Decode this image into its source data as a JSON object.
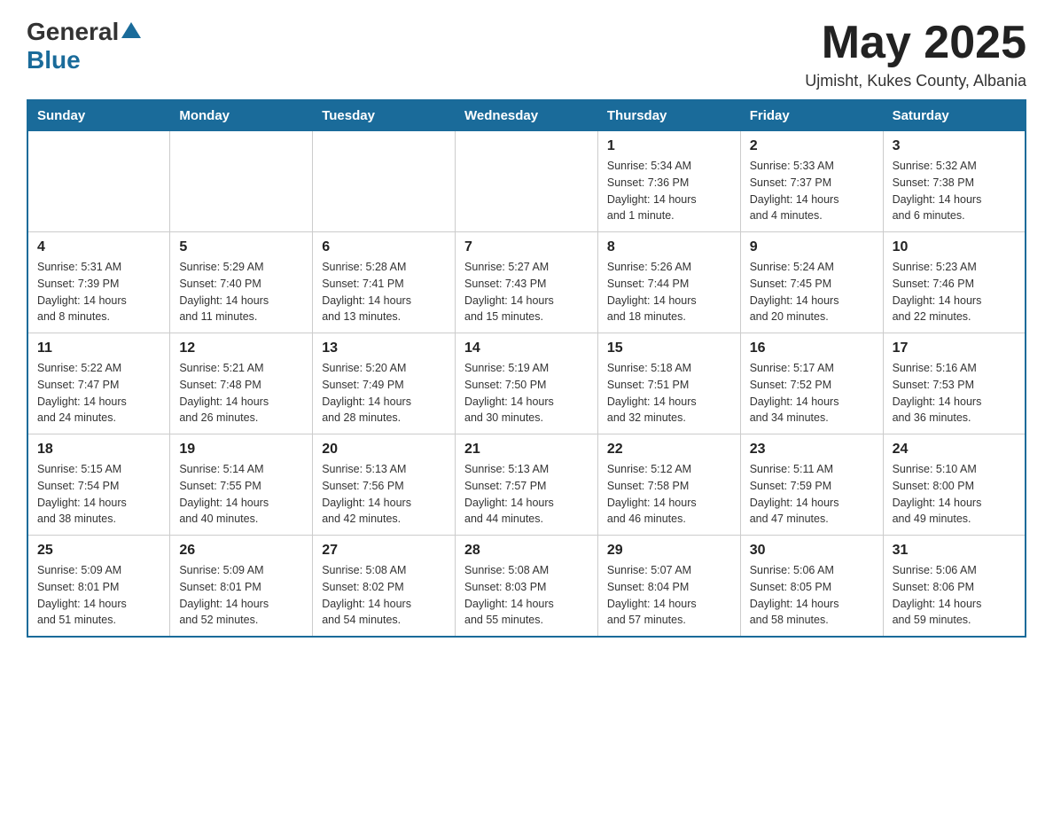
{
  "header": {
    "logo_general": "General",
    "logo_blue": "Blue",
    "title": "May 2025",
    "location": "Ujmisht, Kukes County, Albania"
  },
  "days_of_week": [
    "Sunday",
    "Monday",
    "Tuesday",
    "Wednesday",
    "Thursday",
    "Friday",
    "Saturday"
  ],
  "weeks": [
    [
      {
        "num": "",
        "info": ""
      },
      {
        "num": "",
        "info": ""
      },
      {
        "num": "",
        "info": ""
      },
      {
        "num": "",
        "info": ""
      },
      {
        "num": "1",
        "info": "Sunrise: 5:34 AM\nSunset: 7:36 PM\nDaylight: 14 hours\nand 1 minute."
      },
      {
        "num": "2",
        "info": "Sunrise: 5:33 AM\nSunset: 7:37 PM\nDaylight: 14 hours\nand 4 minutes."
      },
      {
        "num": "3",
        "info": "Sunrise: 5:32 AM\nSunset: 7:38 PM\nDaylight: 14 hours\nand 6 minutes."
      }
    ],
    [
      {
        "num": "4",
        "info": "Sunrise: 5:31 AM\nSunset: 7:39 PM\nDaylight: 14 hours\nand 8 minutes."
      },
      {
        "num": "5",
        "info": "Sunrise: 5:29 AM\nSunset: 7:40 PM\nDaylight: 14 hours\nand 11 minutes."
      },
      {
        "num": "6",
        "info": "Sunrise: 5:28 AM\nSunset: 7:41 PM\nDaylight: 14 hours\nand 13 minutes."
      },
      {
        "num": "7",
        "info": "Sunrise: 5:27 AM\nSunset: 7:43 PM\nDaylight: 14 hours\nand 15 minutes."
      },
      {
        "num": "8",
        "info": "Sunrise: 5:26 AM\nSunset: 7:44 PM\nDaylight: 14 hours\nand 18 minutes."
      },
      {
        "num": "9",
        "info": "Sunrise: 5:24 AM\nSunset: 7:45 PM\nDaylight: 14 hours\nand 20 minutes."
      },
      {
        "num": "10",
        "info": "Sunrise: 5:23 AM\nSunset: 7:46 PM\nDaylight: 14 hours\nand 22 minutes."
      }
    ],
    [
      {
        "num": "11",
        "info": "Sunrise: 5:22 AM\nSunset: 7:47 PM\nDaylight: 14 hours\nand 24 minutes."
      },
      {
        "num": "12",
        "info": "Sunrise: 5:21 AM\nSunset: 7:48 PM\nDaylight: 14 hours\nand 26 minutes."
      },
      {
        "num": "13",
        "info": "Sunrise: 5:20 AM\nSunset: 7:49 PM\nDaylight: 14 hours\nand 28 minutes."
      },
      {
        "num": "14",
        "info": "Sunrise: 5:19 AM\nSunset: 7:50 PM\nDaylight: 14 hours\nand 30 minutes."
      },
      {
        "num": "15",
        "info": "Sunrise: 5:18 AM\nSunset: 7:51 PM\nDaylight: 14 hours\nand 32 minutes."
      },
      {
        "num": "16",
        "info": "Sunrise: 5:17 AM\nSunset: 7:52 PM\nDaylight: 14 hours\nand 34 minutes."
      },
      {
        "num": "17",
        "info": "Sunrise: 5:16 AM\nSunset: 7:53 PM\nDaylight: 14 hours\nand 36 minutes."
      }
    ],
    [
      {
        "num": "18",
        "info": "Sunrise: 5:15 AM\nSunset: 7:54 PM\nDaylight: 14 hours\nand 38 minutes."
      },
      {
        "num": "19",
        "info": "Sunrise: 5:14 AM\nSunset: 7:55 PM\nDaylight: 14 hours\nand 40 minutes."
      },
      {
        "num": "20",
        "info": "Sunrise: 5:13 AM\nSunset: 7:56 PM\nDaylight: 14 hours\nand 42 minutes."
      },
      {
        "num": "21",
        "info": "Sunrise: 5:13 AM\nSunset: 7:57 PM\nDaylight: 14 hours\nand 44 minutes."
      },
      {
        "num": "22",
        "info": "Sunrise: 5:12 AM\nSunset: 7:58 PM\nDaylight: 14 hours\nand 46 minutes."
      },
      {
        "num": "23",
        "info": "Sunrise: 5:11 AM\nSunset: 7:59 PM\nDaylight: 14 hours\nand 47 minutes."
      },
      {
        "num": "24",
        "info": "Sunrise: 5:10 AM\nSunset: 8:00 PM\nDaylight: 14 hours\nand 49 minutes."
      }
    ],
    [
      {
        "num": "25",
        "info": "Sunrise: 5:09 AM\nSunset: 8:01 PM\nDaylight: 14 hours\nand 51 minutes."
      },
      {
        "num": "26",
        "info": "Sunrise: 5:09 AM\nSunset: 8:01 PM\nDaylight: 14 hours\nand 52 minutes."
      },
      {
        "num": "27",
        "info": "Sunrise: 5:08 AM\nSunset: 8:02 PM\nDaylight: 14 hours\nand 54 minutes."
      },
      {
        "num": "28",
        "info": "Sunrise: 5:08 AM\nSunset: 8:03 PM\nDaylight: 14 hours\nand 55 minutes."
      },
      {
        "num": "29",
        "info": "Sunrise: 5:07 AM\nSunset: 8:04 PM\nDaylight: 14 hours\nand 57 minutes."
      },
      {
        "num": "30",
        "info": "Sunrise: 5:06 AM\nSunset: 8:05 PM\nDaylight: 14 hours\nand 58 minutes."
      },
      {
        "num": "31",
        "info": "Sunrise: 5:06 AM\nSunset: 8:06 PM\nDaylight: 14 hours\nand 59 minutes."
      }
    ]
  ]
}
